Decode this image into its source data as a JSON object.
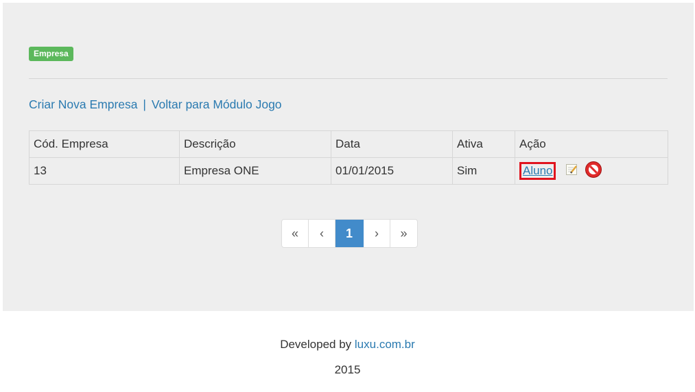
{
  "badge": "Empresa",
  "links": {
    "create": "Criar Nova Empresa",
    "separator": "|",
    "back": "Voltar para Módulo Jogo"
  },
  "table": {
    "headers": [
      "Cód. Empresa",
      "Descrição",
      "Data",
      "Ativa",
      "Ação"
    ],
    "rows": [
      {
        "codigo": "13",
        "descricao": "Empresa ONE",
        "data": "01/01/2015",
        "ativa": "Sim",
        "acao_link": "Aluno",
        "icons": [
          "edit-icon",
          "delete-icon"
        ]
      }
    ]
  },
  "pagination": {
    "first": "«",
    "prev": "‹",
    "current": "1",
    "next": "›",
    "last": "»"
  },
  "footer": {
    "developed_by": "Developed by",
    "site": "luxu.com.br",
    "year": "2015"
  },
  "colors": {
    "badge": "#5cb85c",
    "link": "#2a7ab0",
    "active_page": "#428bca",
    "highlight_box": "#e0141e",
    "panel": "#eeeeee"
  }
}
